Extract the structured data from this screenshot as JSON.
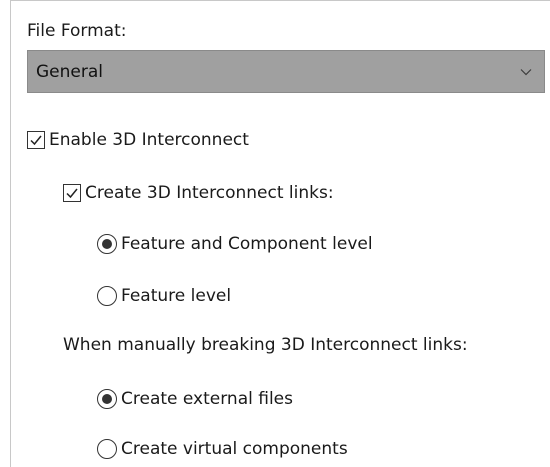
{
  "file_format": {
    "label": "File Format:",
    "selected": "General",
    "arrow_icon": "chevron-down-icon"
  },
  "enable_3d": {
    "label": "Enable 3D Interconnect",
    "checked": true
  },
  "create_links": {
    "label": "Create 3D Interconnect links:",
    "checked": true,
    "options": [
      {
        "label": "Feature and Component level",
        "checked": true
      },
      {
        "label": "Feature level",
        "checked": false
      }
    ]
  },
  "breaking": {
    "label": "When manually breaking 3D Interconnect links:",
    "options": [
      {
        "label": "Create external files",
        "checked": true
      },
      {
        "label": "Create virtual components",
        "checked": false
      }
    ]
  }
}
